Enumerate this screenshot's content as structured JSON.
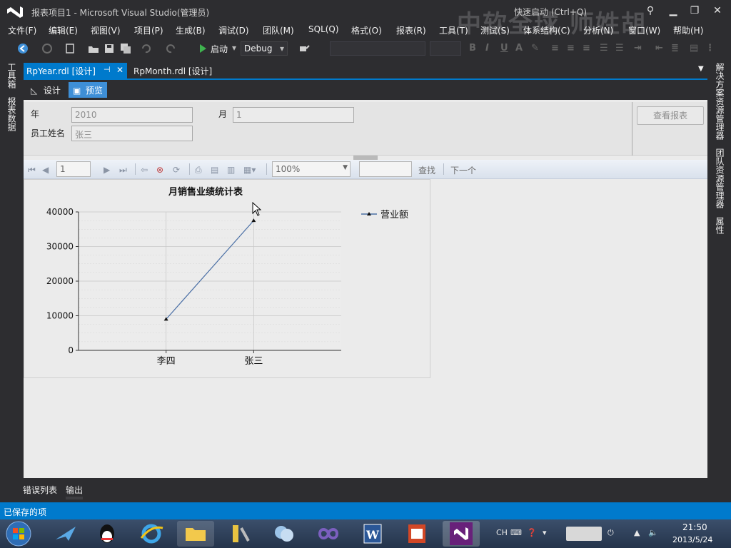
{
  "window": {
    "title": "报表项目1 - Microsoft Visual Studio(管理员)",
    "quick_launch": "快速启动 (Ctrl+Q)",
    "watermark": "中软全球 师姓胡"
  },
  "menu": [
    "文件(F)",
    "编辑(E)",
    "视图(V)",
    "项目(P)",
    "生成(B)",
    "调试(D)",
    "团队(M)",
    "SQL(Q)",
    "格式(O)",
    "报表(R)",
    "工具(T)",
    "测试(S)",
    "体系结构(C)",
    "分析(N)",
    "窗口(W)",
    "帮助(H)"
  ],
  "toolbar": {
    "start_label": "启动",
    "config_value": "Debug"
  },
  "left_strip": [
    "工具箱",
    "报表数据"
  ],
  "right_strip": [
    "解决方案资源管理器",
    "团队资源管理器",
    "属性"
  ],
  "tabs": [
    {
      "label": "RpYear.rdl [设计]",
      "active": true
    },
    {
      "label": "RpMonth.rdl [设计]",
      "active": false
    }
  ],
  "subtabs": {
    "design": "设计",
    "preview": "预览"
  },
  "params": {
    "year_label": "年",
    "year_value": "2010",
    "month_label": "月",
    "month_value": "1",
    "employee_label": "员工姓名",
    "employee_value": "张三",
    "view_report_label": "查看报表"
  },
  "viewer_toolbar": {
    "page_value": "1",
    "zoom_value": "100%",
    "find_label": "查找",
    "next_label": "下一个"
  },
  "chart_data": {
    "type": "line",
    "title": "月销售业绩统计表",
    "categories": [
      "李四",
      "张三"
    ],
    "series": [
      {
        "name": "营业额",
        "values": [
          9000,
          37500
        ],
        "color": "#4a6fa5"
      }
    ],
    "ylim": [
      0,
      40000
    ],
    "yticks": [
      0,
      10000,
      20000,
      30000,
      40000
    ],
    "grid": true,
    "legend": "right"
  },
  "bottom_tabs": [
    "错误列表",
    "输出"
  ],
  "status": "已保存的项",
  "taskbar": {
    "lang": "CH",
    "time": "21:50",
    "date": "2013/5/24"
  },
  "colors": {
    "accent": "#007acc",
    "chrome": "#2d2d30",
    "preview_tab": "#3e8fd7"
  }
}
